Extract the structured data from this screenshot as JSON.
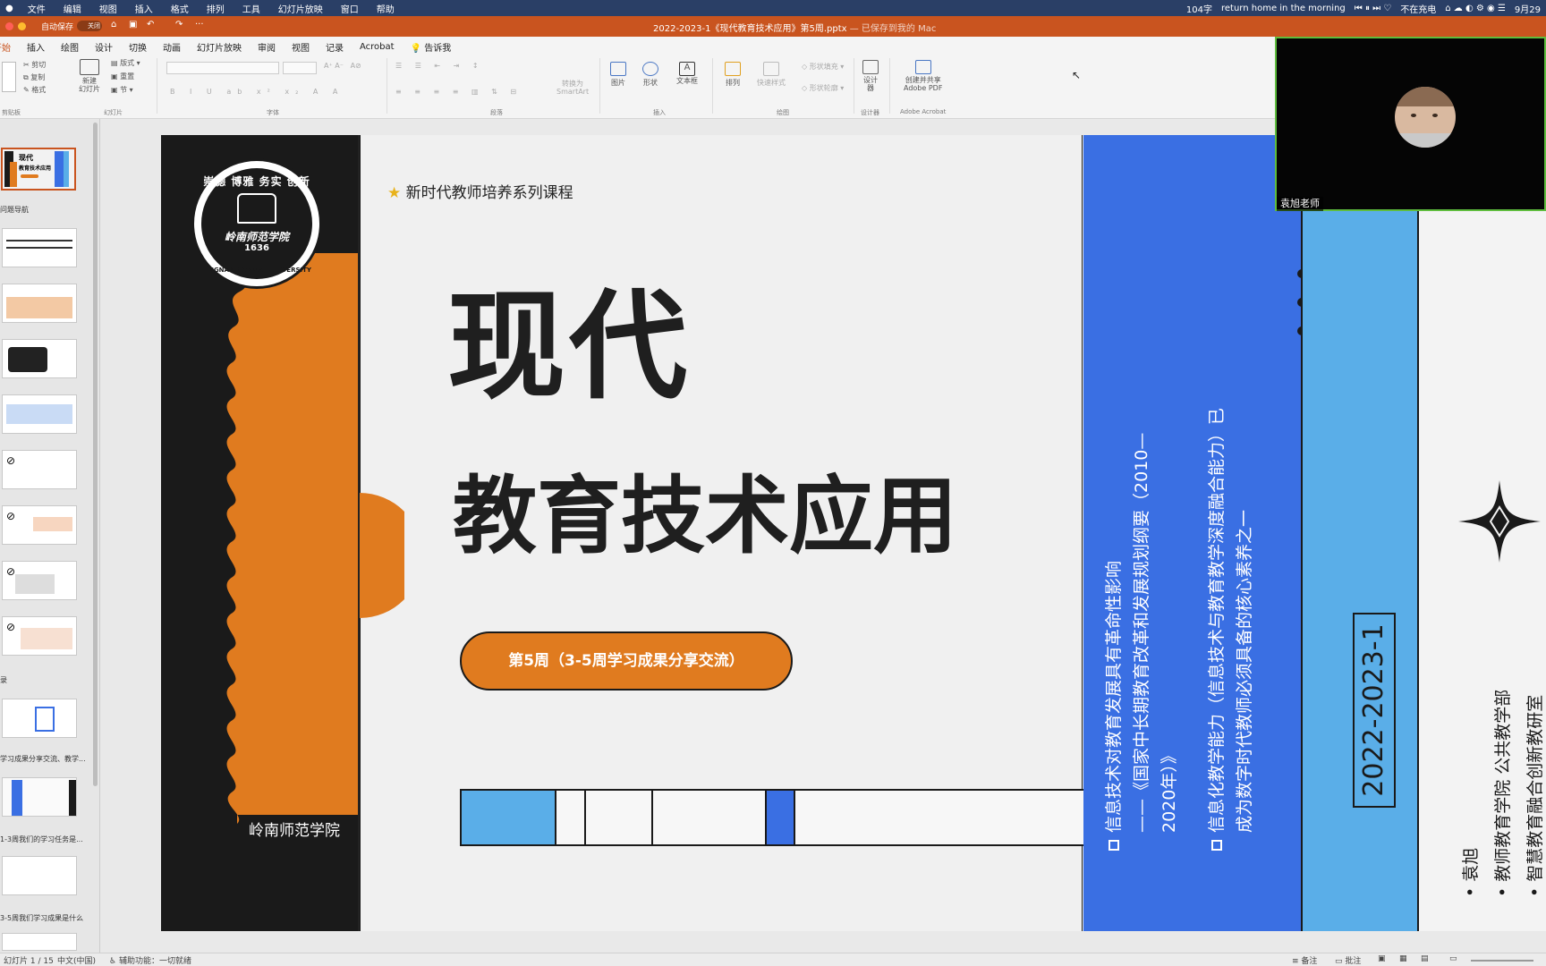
{
  "menubar": {
    "items": [
      "文件",
      "编辑",
      "视图",
      "插入",
      "格式",
      "排列",
      "工具",
      "幻灯片放映",
      "窗口",
      "帮助"
    ],
    "word_count": "104字",
    "now_playing": "return home in the morning",
    "charging": "不在充电",
    "date": "9月29"
  },
  "titlebar": {
    "autosave_label": "自动保存",
    "autosave_state": "关闭",
    "doc_title": "2022-2023-1《现代教育技术应用》第5周.pptx",
    "saved_status": "— 已保存到我的 Mac"
  },
  "ribbon": {
    "tabs": [
      "开始",
      "插入",
      "绘图",
      "设计",
      "切换",
      "动画",
      "幻灯片放映",
      "审阅",
      "视图",
      "记录",
      "Acrobat"
    ],
    "tell_me": "告诉我",
    "buttons": {
      "cut": "剪切",
      "copy": "复制",
      "format": "格式",
      "new_slide": "新建\n幻灯片",
      "layout": "版式",
      "reset": "重置",
      "section": "节",
      "convert_smartart": "转换为\nSmartArt",
      "picture": "图片",
      "shape": "形状",
      "textbox": "文本框",
      "arrange": "排列",
      "quick_styles": "快速样式",
      "shape_fill": "形状填充",
      "shape_outline": "形状轮廓",
      "designer": "设计\n器",
      "create_pdf": "创建并共享\nAdobe PDF"
    },
    "groups": {
      "clipboard": "剪贴板",
      "slides": "幻灯片",
      "font": "字体",
      "paragraph": "段落",
      "insert": "插入",
      "drawing": "绘图",
      "designer": "设计器",
      "acrobat": "Adobe Acrobat"
    }
  },
  "sidebar": {
    "sections": [
      "问题导航",
      "录",
      "学习成果分享交流、教学...",
      "1-3周我们的学习任务是...",
      "3-5周我们学习成果是什么"
    ],
    "thumb1_title": "现代",
    "thumb1_subtitle": "教育技术应用"
  },
  "slide": {
    "series": "新时代教师培养系列课程",
    "title_line1": "现代",
    "title_line2": "教育技术应用",
    "week_badge": "第5周（3-5周学习成果分享交流）",
    "school": "岭南师范学院",
    "logo": {
      "top_text": "崇德 博雅 务实 创新",
      "center_text": "岭南师范学院",
      "year": "1636",
      "ring_text": "LINGNAN NORMAL UNIVERSITY"
    },
    "bullet1_line1": "信息技术对教育发展具有革命性影响",
    "bullet1_line2": "——《国家中长期教育改革和发展规划纲要（2010—",
    "bullet1_line3": "2020年）》",
    "bullet2_line1": "信息化教学能力（信息技术与教育教学深度融合能力）已",
    "bullet2_line2": "成为数字时代教师必须具备的核心素养之一",
    "term": "2022-2023-1",
    "info1": "袁旭",
    "info2": "教师教育学院 公共教学部",
    "info3": "智慧教育融合创新教研室",
    "colors": {
      "orange": "#e07b1f",
      "blue": "#3a6fe3",
      "light_blue": "#5aaee8",
      "dark": "#1a1a1a"
    }
  },
  "statusbar": {
    "slide_info": "幻灯片 1 / 15",
    "language": "中文(中国)",
    "accessibility": "辅助功能：一切就绪",
    "notes": "备注",
    "comments": "批注"
  },
  "video": {
    "name": "袁旭老师"
  }
}
